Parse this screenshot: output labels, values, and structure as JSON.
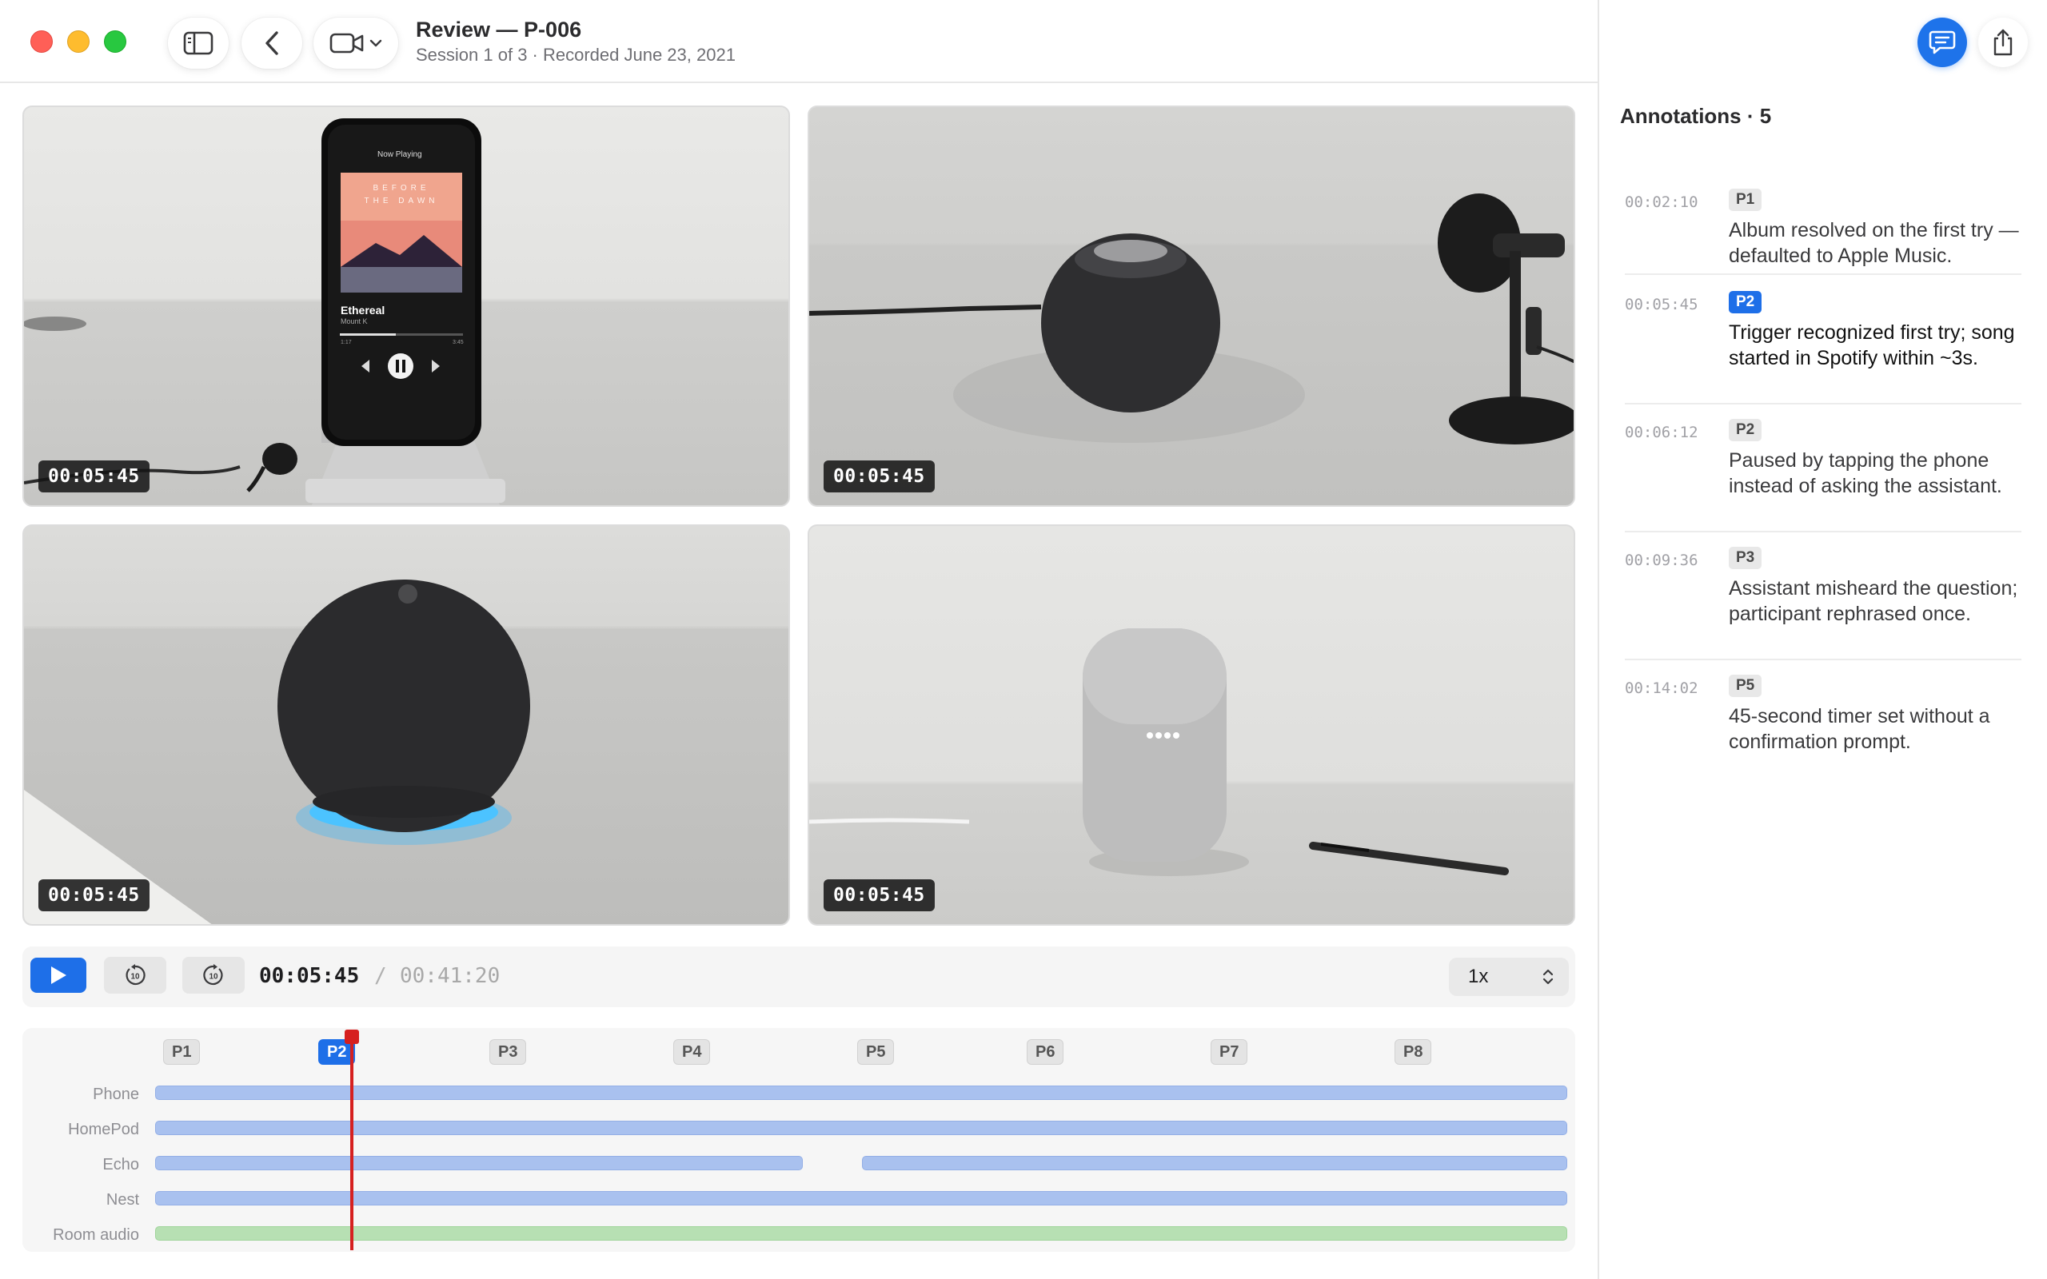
{
  "header": {
    "title": "Review — P-006",
    "subtitle": "Session 1 of 3 · Recorded June 23, 2021"
  },
  "videos": [
    {
      "timestamp": "00:05:45",
      "device": "Phone"
    },
    {
      "timestamp": "00:05:45",
      "device": "HomePod"
    },
    {
      "timestamp": "00:05:45",
      "device": "Echo"
    },
    {
      "timestamp": "00:05:45",
      "device": "Nest"
    }
  ],
  "phone_screen": {
    "now_playing": "Now Playing",
    "album_art_text": "BEFORE THE DAWN",
    "track": "Ethereal",
    "artist": "Mount K",
    "elapsed": "1:17",
    "duration": "3:45"
  },
  "transport": {
    "current_time": "00:05:45",
    "separator": "/",
    "total_time": "00:41:20",
    "speed": "1x",
    "skip_seconds": "10"
  },
  "timeline": {
    "markers": [
      {
        "label": "P1",
        "active": false
      },
      {
        "label": "P2",
        "active": true
      },
      {
        "label": "P3",
        "active": false
      },
      {
        "label": "P4",
        "active": false
      },
      {
        "label": "P5",
        "active": false
      },
      {
        "label": "P6",
        "active": false
      },
      {
        "label": "P7",
        "active": false
      },
      {
        "label": "P8",
        "active": false
      }
    ],
    "tracks": [
      "Phone",
      "HomePod",
      "Echo",
      "Nest",
      "Room audio"
    ],
    "playhead_time": "00:05:45"
  },
  "annotations": {
    "header": "Annotations · 5",
    "items": [
      {
        "time": "00:02:10",
        "tag": "P1",
        "text": "Album resolved on the first try — defaulted to Apple Music.",
        "active": false
      },
      {
        "time": "00:05:45",
        "tag": "P2",
        "text": "Trigger recognized first try; song started in Spotify within ~3s.",
        "active": true
      },
      {
        "time": "00:06:12",
        "tag": "P2",
        "text": "Paused by tapping the phone instead of asking the assistant.",
        "active": false
      },
      {
        "time": "00:09:36",
        "tag": "P3",
        "text": "Assistant misheard the question; participant rephrased once.",
        "active": false
      },
      {
        "time": "00:14:02",
        "tag": "P5",
        "text": "45-second timer set without a confirmation prompt.",
        "active": false
      }
    ]
  },
  "colors": {
    "accent": "#1e6fe8",
    "playhead": "#d6201f",
    "video_track": "#a9c1ef",
    "audio_track": "#b7e0b3"
  },
  "icons": [
    "sidebar-toggle-icon",
    "chevron-left-icon",
    "video-camera-icon",
    "chevron-down-icon",
    "play-icon",
    "skip-back-10-icon",
    "skip-forward-10-icon",
    "up-down-chevron-icon",
    "comment-icon",
    "share-icon"
  ]
}
